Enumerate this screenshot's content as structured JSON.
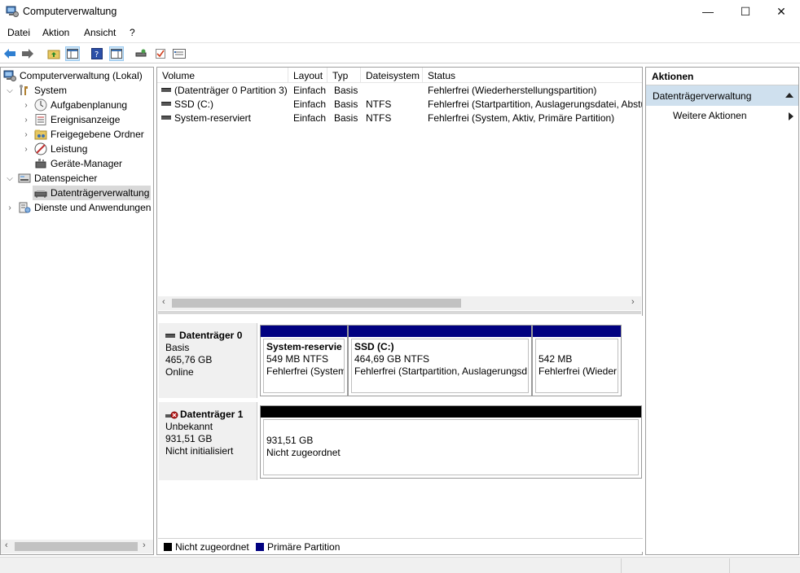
{
  "window": {
    "title": "Computerverwaltung",
    "controls": {
      "minimize": "—",
      "maximize": "☐",
      "close": "✕"
    }
  },
  "menu": [
    "Datei",
    "Aktion",
    "Ansicht",
    "?"
  ],
  "tree": {
    "root": "Computerverwaltung (Lokal)",
    "items": [
      {
        "label": "System",
        "level": 1,
        "expanded": true,
        "icon": "tools-icon"
      },
      {
        "label": "Aufgabenplanung",
        "level": 2,
        "icon": "clock-icon"
      },
      {
        "label": "Ereignisanzeige",
        "level": 2,
        "icon": "event-viewer-icon"
      },
      {
        "label": "Freigegebene Ordner",
        "level": 2,
        "icon": "shared-folder-icon"
      },
      {
        "label": "Leistung",
        "level": 2,
        "icon": "performance-icon"
      },
      {
        "label": "Geräte-Manager",
        "level": 2,
        "icon": "device-manager-icon"
      },
      {
        "label": "Datenspeicher",
        "level": 1,
        "expanded": true,
        "icon": "storage-icon"
      },
      {
        "label": "Datenträgerverwaltung",
        "level": 2,
        "selected": true,
        "icon": "disk-management-icon"
      },
      {
        "label": "Dienste und Anwendungen",
        "level": 1,
        "icon": "services-icon"
      }
    ]
  },
  "volume_list": {
    "columns": [
      "Volume",
      "Layout",
      "Typ",
      "Dateisystem",
      "Status"
    ],
    "rows": [
      {
        "volume": "(Datenträger 0 Partition 3)",
        "layout": "Einfach",
        "typ": "Basis",
        "dateisystem": "",
        "status": "Fehlerfrei (Wiederherstellungspartition)"
      },
      {
        "volume": "SSD (C:)",
        "layout": "Einfach",
        "typ": "Basis",
        "dateisystem": "NTFS",
        "status": "Fehlerfrei (Startpartition, Auslagerungsdatei, Absturzspeicherabbild, Primäre Partition)"
      },
      {
        "volume": "System-reserviert",
        "layout": "Einfach",
        "typ": "Basis",
        "dateisystem": "NTFS",
        "status": "Fehlerfrei (System, Aktiv, Primäre Partition)"
      }
    ]
  },
  "disks": [
    {
      "name": "Datenträger 0",
      "type": "Basis",
      "size": "465,76 GB",
      "state": "Online",
      "partitions": [
        {
          "name": "System-reservie",
          "size": "549 MB NTFS",
          "status": "Fehlerfrei (System",
          "color": "#000080"
        },
        {
          "name": "SSD  (C:)",
          "size": "464,69 GB NTFS",
          "status": "Fehlerfrei (Startpartition, Auslagerungsd",
          "color": "#000080"
        },
        {
          "name": "",
          "size": "542 MB",
          "status": "Fehlerfrei (Wieder",
          "color": "#000080"
        }
      ]
    },
    {
      "name": "Datenträger 1",
      "type": "Unbekannt",
      "size": "931,51 GB",
      "state": "Nicht initialisiert",
      "partitions": [
        {
          "name": "",
          "size": "931,51 GB",
          "status": "Nicht zugeordnet",
          "color": "#000000"
        }
      ]
    }
  ],
  "legend": [
    {
      "label": "Nicht zugeordnet",
      "color": "#000000"
    },
    {
      "label": "Primäre Partition",
      "color": "#000080"
    }
  ],
  "actions": {
    "header": "Aktionen",
    "section": "Datenträgerverwaltung",
    "more": "Weitere Aktionen"
  }
}
